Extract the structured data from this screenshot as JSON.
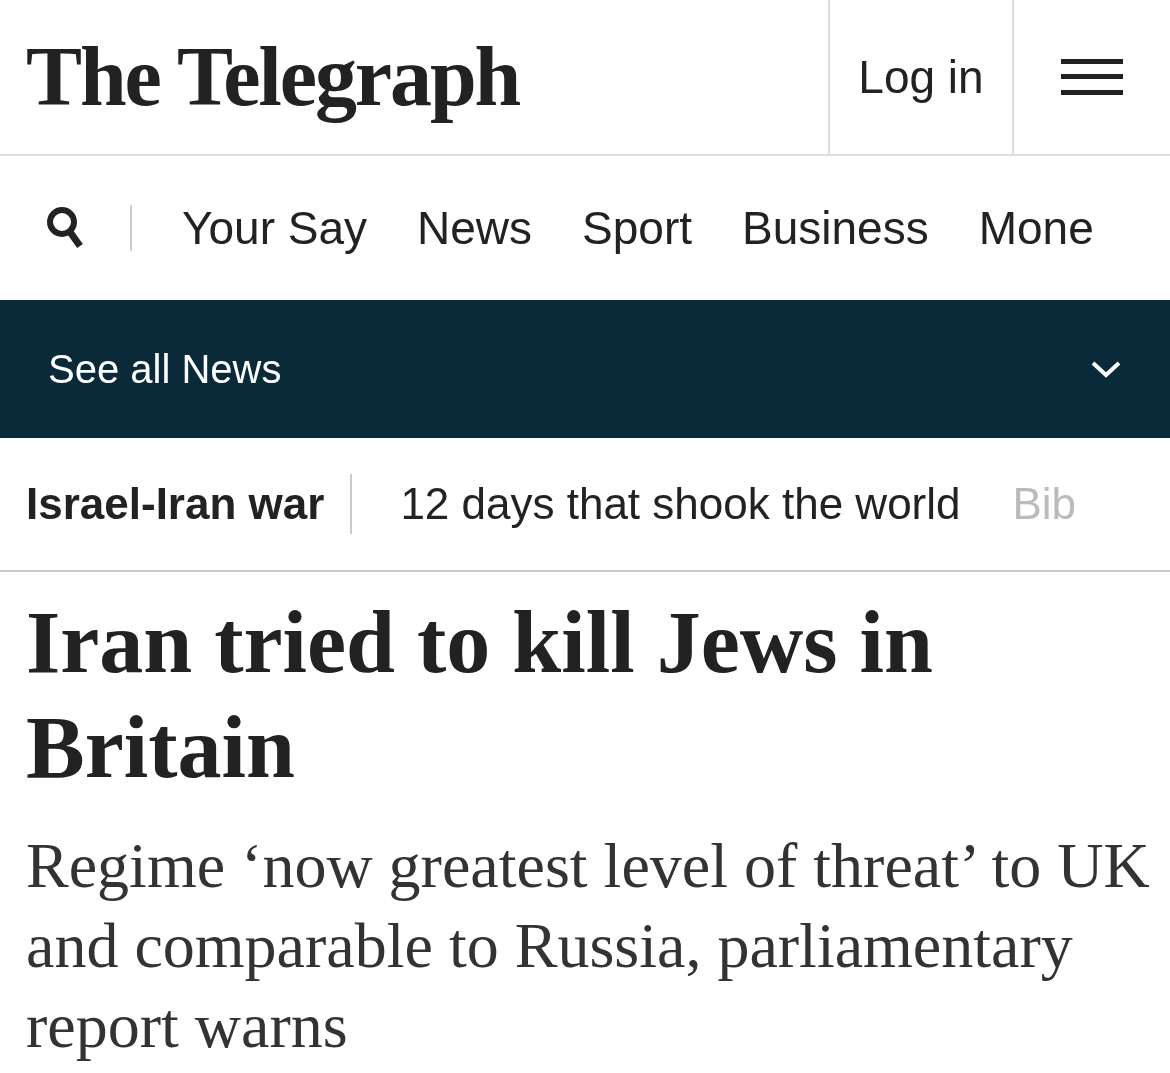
{
  "header": {
    "logo": "The Telegraph",
    "login": "Log in"
  },
  "nav": {
    "items": [
      "Your Say",
      "News",
      "Sport",
      "Business",
      "Mone"
    ]
  },
  "section_bar": {
    "label": "See all News",
    "expanded": false
  },
  "topics": [
    {
      "label": "Israel-Iran war",
      "kind": "tag"
    },
    {
      "label": "12 days that shook the world",
      "kind": "link"
    },
    {
      "label": "Bib",
      "kind": "faded"
    }
  ],
  "article": {
    "headline": "Iran tried to kill Jews in Britain",
    "standfirst": "Regime ‘now greatest level of threat’ to UK and comparable to Russia, parliamentary report warns"
  }
}
